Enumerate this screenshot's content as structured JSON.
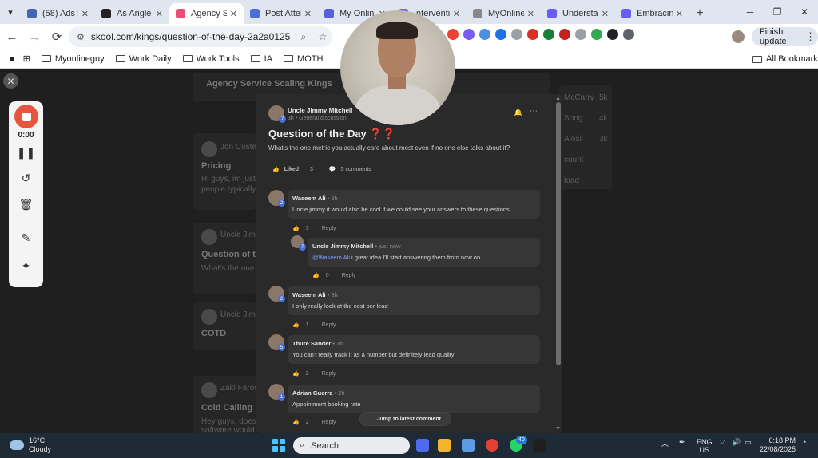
{
  "browser": {
    "tabs": [
      {
        "title": "(58) Ads M",
        "color": "#4267b2",
        "active": false
      },
      {
        "title": "As Angle",
        "color": "#222222",
        "active": false
      },
      {
        "title": "Agency Se",
        "color": "#e94e77",
        "active": true
      },
      {
        "title": "Post Atter",
        "color": "#4a6fd6",
        "active": false
      },
      {
        "title": "My Online",
        "color": "#5561d6",
        "active": false
      },
      {
        "title": "Interventi",
        "color": "#7a5af8",
        "active": false
      },
      {
        "title": "MyOnline",
        "color": "#888888",
        "active": false
      },
      {
        "title": "Understa",
        "color": "#6b5cf6",
        "active": false
      },
      {
        "title": "Embracing",
        "color": "#6b5cf6",
        "active": false
      }
    ],
    "url": "skool.com/kings/question-of-the-day-2a2a0125",
    "finish_update": "Finish update",
    "bookmarks": [
      "Myonlineguy",
      "Work Daily",
      "Work Tools",
      "IA",
      "MOTH"
    ],
    "all_bookmarks": "All Bookmarks",
    "extension_colors": [
      "#ea4335",
      "#7a5af8",
      "#4a90e2",
      "#1a73e8",
      "#9aa0a6",
      "#d93025",
      "#188038",
      "#c5221f",
      "#9aa0a6",
      "#34a853",
      "#202124",
      "#5f6368"
    ]
  },
  "recorder": {
    "time": "0:00",
    "stop_color": "#e8553f"
  },
  "background": {
    "group_name": "Agency Service Scaling Kings",
    "posts": [
      {
        "author": "Jon Costeo",
        "title": "Pricing",
        "snippet": "Hi guys, im just star...",
        "snippet2": "people typically fo..."
      },
      {
        "author": "Uncle Jimmy",
        "title": "Question of the",
        "snippet": "What's the one me..."
      },
      {
        "author": "Uncle Jimmy",
        "title": "COTD",
        "snippet": ""
      },
      {
        "author": "Zaki Farooqu",
        "title": "Cold Calling",
        "snippet": "Hey guys, does any...",
        "snippet2": "software would be..."
      }
    ],
    "sidebar_rows": [
      {
        "name": "McCarry",
        "val": "5k"
      },
      {
        "name": "Song",
        "val": "4k"
      },
      {
        "name": "Alosil",
        "val": "3k"
      },
      {
        "name": "count",
        "val": ""
      },
      {
        "name": "load",
        "val": ""
      }
    ]
  },
  "post": {
    "author": "Uncle Jimmy Mitchell",
    "author_level": "7",
    "meta": "3h • General discussion",
    "title": "Question of the Day ❓❓",
    "body": "What's the one metric you actually care about most even if no one else talks about it?",
    "liked_label": "Liked",
    "likes": "3",
    "comments_label": "5 comments"
  },
  "comments": [
    {
      "author": "Waseem Ali",
      "time": " • 3h",
      "level": "2",
      "text": "Uncle jimmy it would also be cool if we could see your answers to these questions",
      "likes": "3",
      "reply": "Reply"
    },
    {
      "author": "Uncle Jimmy Mitchell",
      "time": " • just now",
      "level": "7",
      "mention": "@Waseem Ali",
      "text": " i great idea I'll start answering them from now on",
      "likes": "0",
      "reply": "Reply"
    },
    {
      "author": "Waseem Ali",
      "time": " • 3h",
      "level": "2",
      "text": "I only really look at the cost per lead",
      "likes": "1",
      "reply": "Reply"
    },
    {
      "author": "Thure Sander",
      "time": " • 3h",
      "level": "5",
      "text": "You can't really track it as a number but definitely lead quality",
      "likes": "2",
      "reply": "Reply"
    },
    {
      "author": "Adrian Guerra",
      "time": " • 2h",
      "level": "1",
      "text": "Appointment booking rate",
      "likes": "2",
      "reply": "Reply"
    }
  ],
  "jump_label": "Jump to latest comment",
  "taskbar": {
    "weather_temp": "16°C",
    "weather_desc": "Cloudy",
    "search_label": "Search",
    "whatsapp_badge": "40",
    "lang": "ENG",
    "region": "US",
    "time": "6:18 PM",
    "date": "22/08/2025",
    "app_colors": [
      "#4f6bed",
      "#f3b52d",
      "#5e9be6",
      "#e34133",
      "#25d366",
      "#1f1f1f"
    ]
  }
}
